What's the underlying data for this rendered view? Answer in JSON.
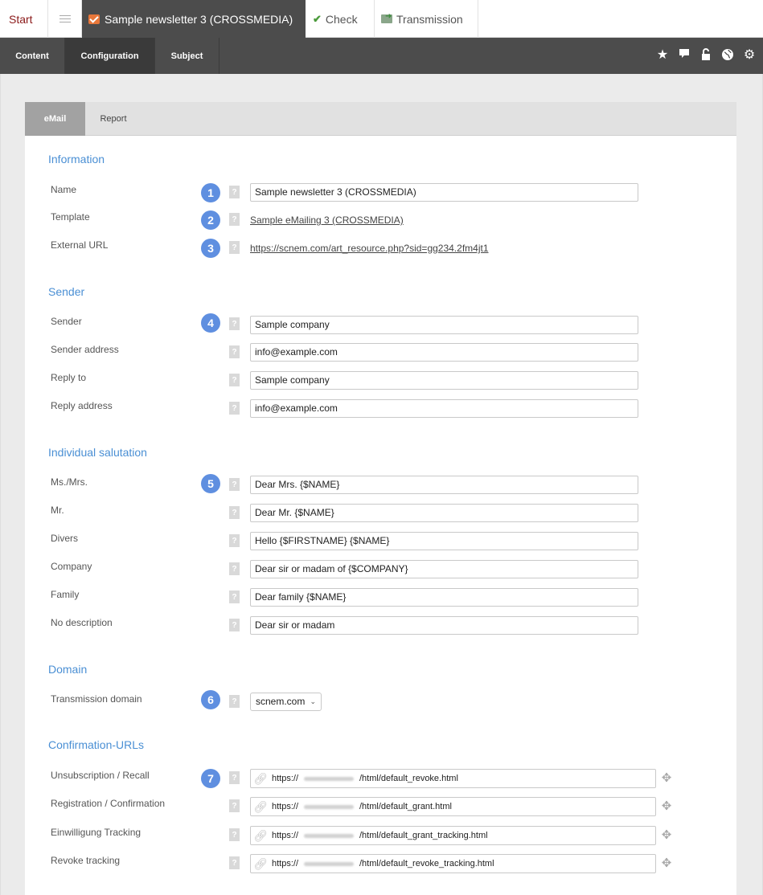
{
  "top_tabs": {
    "start": "Start",
    "active_title": "Sample newsletter 3 (CROSSMEDIA)",
    "check": "Check",
    "transmission": "Transmission"
  },
  "nav_tabs": {
    "content": "Content",
    "configuration": "Configuration",
    "subject": "Subject"
  },
  "nav_icons": [
    "star-icon",
    "comment-icon",
    "unlock-icon",
    "globe-icon",
    "gear-icon"
  ],
  "sub_tabs": {
    "email": "eMail",
    "report": "Report"
  },
  "help_glyph": "?",
  "information": {
    "heading": "Information",
    "name_label": "Name",
    "name_value": "Sample newsletter 3 (CROSSMEDIA)",
    "template_label": "Template",
    "template_value": "Sample eMailing 3 (CROSSMEDIA)",
    "external_url_label": "External URL",
    "external_url_value": "https://scnem.com/art_resource.php?sid=gg234.2fm4jt1"
  },
  "sender": {
    "heading": "Sender",
    "sender_label": "Sender",
    "sender_value": "Sample company",
    "sender_address_label": "Sender address",
    "sender_address_value": "info@example.com",
    "reply_to_label": "Reply to",
    "reply_to_value": "Sample company",
    "reply_address_label": "Reply address",
    "reply_address_value": "info@example.com"
  },
  "salutation": {
    "heading": "Individual salutation",
    "rows": [
      {
        "label": "Ms./Mrs.",
        "value": "Dear Mrs. {$NAME}"
      },
      {
        "label": "Mr.",
        "value": "Dear Mr. {$NAME}"
      },
      {
        "label": "Divers",
        "value": "Hello {$FIRSTNAME} {$NAME}"
      },
      {
        "label": "Company",
        "value": "Dear sir or madam of {$COMPANY}"
      },
      {
        "label": "Family",
        "value": "Dear family {$NAME}"
      },
      {
        "label": "No description",
        "value": "Dear sir or madam"
      }
    ]
  },
  "domain": {
    "heading": "Domain",
    "label": "Transmission domain",
    "value": "scnem.com"
  },
  "confirmation": {
    "heading": "Confirmation-URLs",
    "url_prefix": "https://",
    "rows": [
      {
        "label": "Unsubscription / Recall",
        "path": "/html/default_revoke.html"
      },
      {
        "label": "Registration / Confirmation",
        "path": "/html/default_grant.html"
      },
      {
        "label": "Einwilligung Tracking",
        "path": "/html/default_grant_tracking.html"
      },
      {
        "label": "Revoke tracking",
        "path": "/html/default_revoke_tracking.html"
      }
    ]
  },
  "callouts": [
    "1",
    "2",
    "3",
    "4",
    "5",
    "6",
    "7"
  ],
  "colors": {
    "accent": "#4a8fd4",
    "callout": "#5f8fe0",
    "dark_nav": "#4c4c4c",
    "start": "#8b1a1a"
  }
}
